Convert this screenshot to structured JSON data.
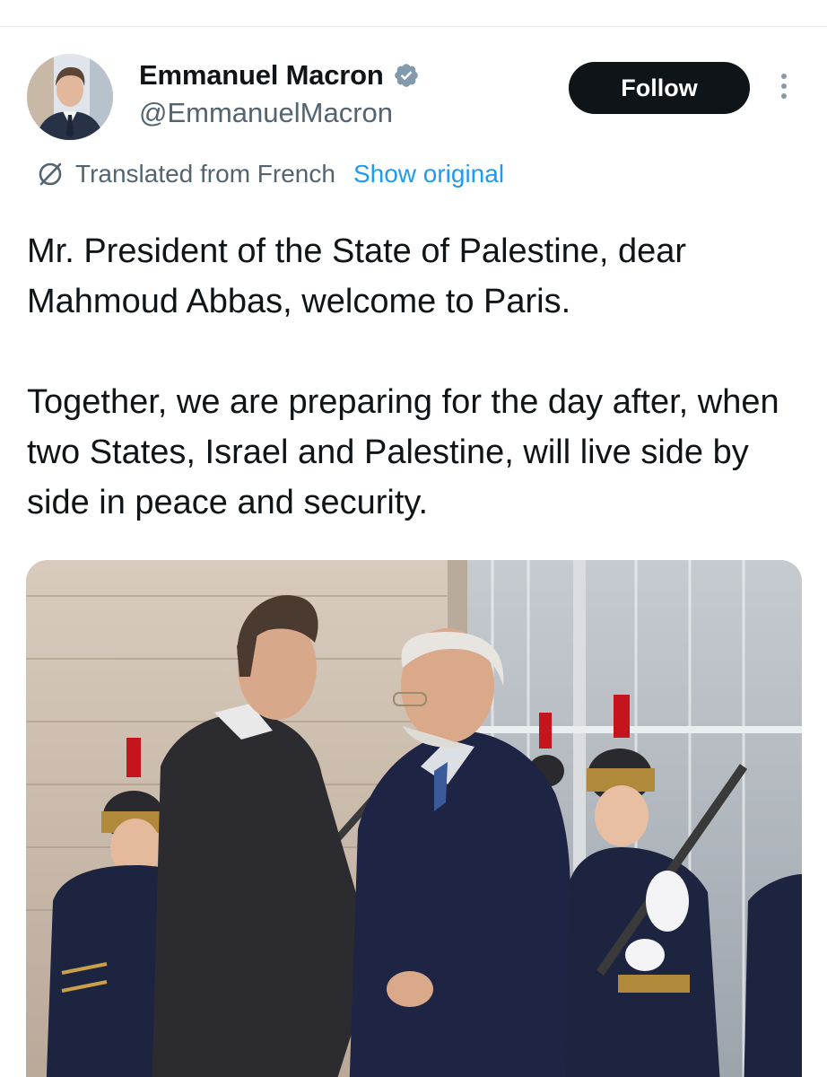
{
  "tweet": {
    "author": {
      "display_name": "Emmanuel Macron",
      "handle": "@EmmanuelMacron",
      "verified": true
    },
    "follow_label": "Follow",
    "translation": {
      "label": "Translated from French",
      "show_original": "Show original"
    },
    "paragraphs": [
      "Mr. President of the State of Palestine, dear Mahmoud Abbas, welcome to Paris.",
      "Together, we are preparing for the day after, when two States, Israel and Palestine, will live side by side in peace and security."
    ]
  },
  "colors": {
    "text_primary": "#0f1419",
    "text_secondary": "#536471",
    "link": "#1d9bf0",
    "verified_badge": "#829aab",
    "follow_bg": "#0f1419"
  },
  "icons": {
    "verified": "verified-badge-icon",
    "translate": "translate-icon",
    "more": "more-options-icon"
  }
}
